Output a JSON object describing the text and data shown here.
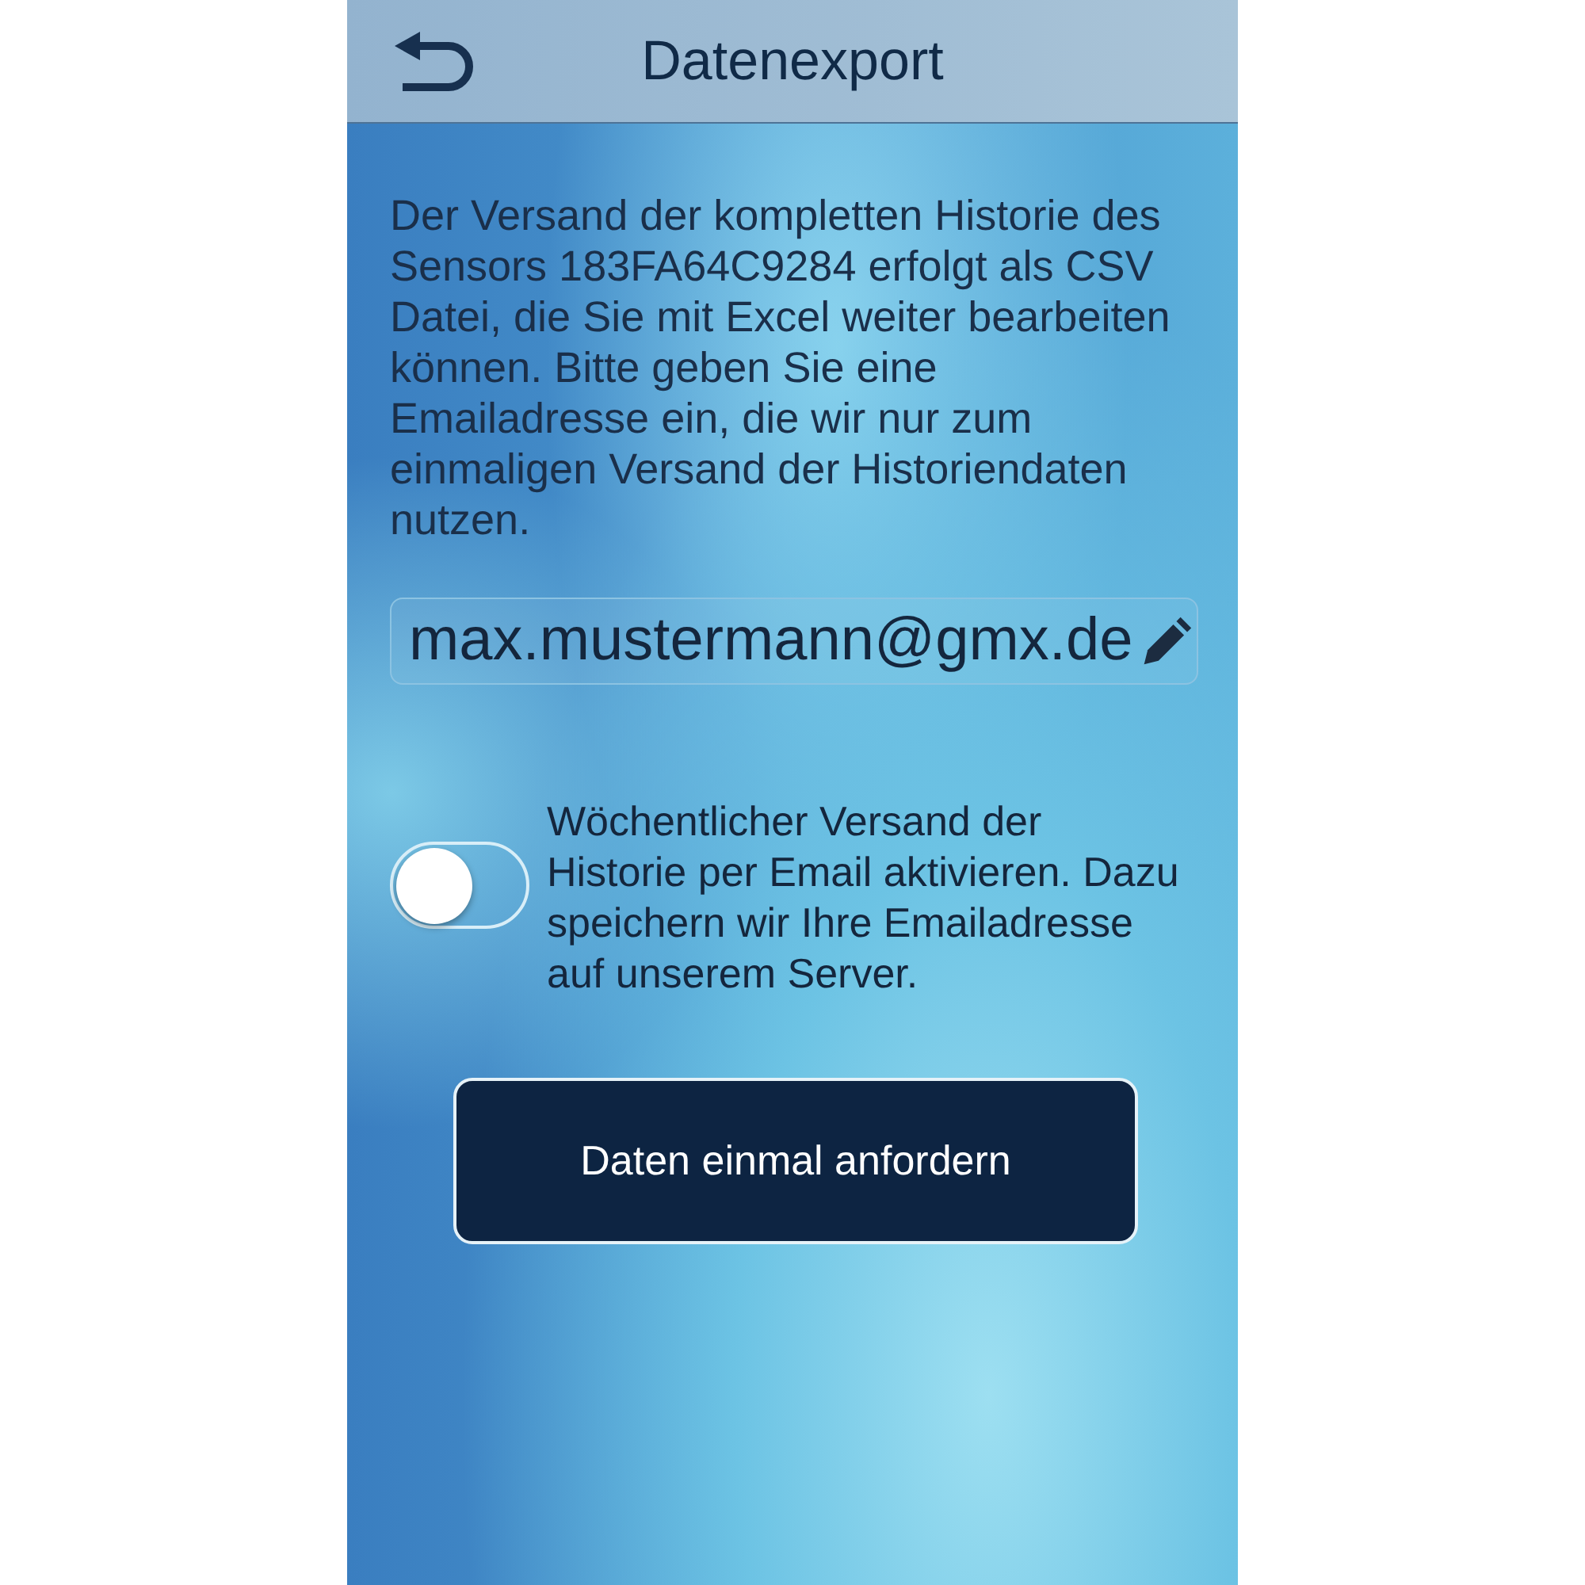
{
  "header": {
    "title": "Datenexport"
  },
  "intro": "Der Versand der kompletten Historie des Sensors 183FA64C9284 erfolgt als CSV Datei, die Sie mit Excel weiter bearbeiten können. Bitte geben Sie eine Emailadresse ein, die wir nur zum einmaligen Versand der Historiendaten nutzen.",
  "email_field": {
    "value": "max.mustermann@gmx.de"
  },
  "weekly_toggle": {
    "on": false,
    "label": "Wöchentlicher Versand der Historie per Email aktivieren. Dazu speichern wir Ihre Emailadresse auf unserem Server."
  },
  "request_button": {
    "label": "Daten einmal anfordern"
  }
}
